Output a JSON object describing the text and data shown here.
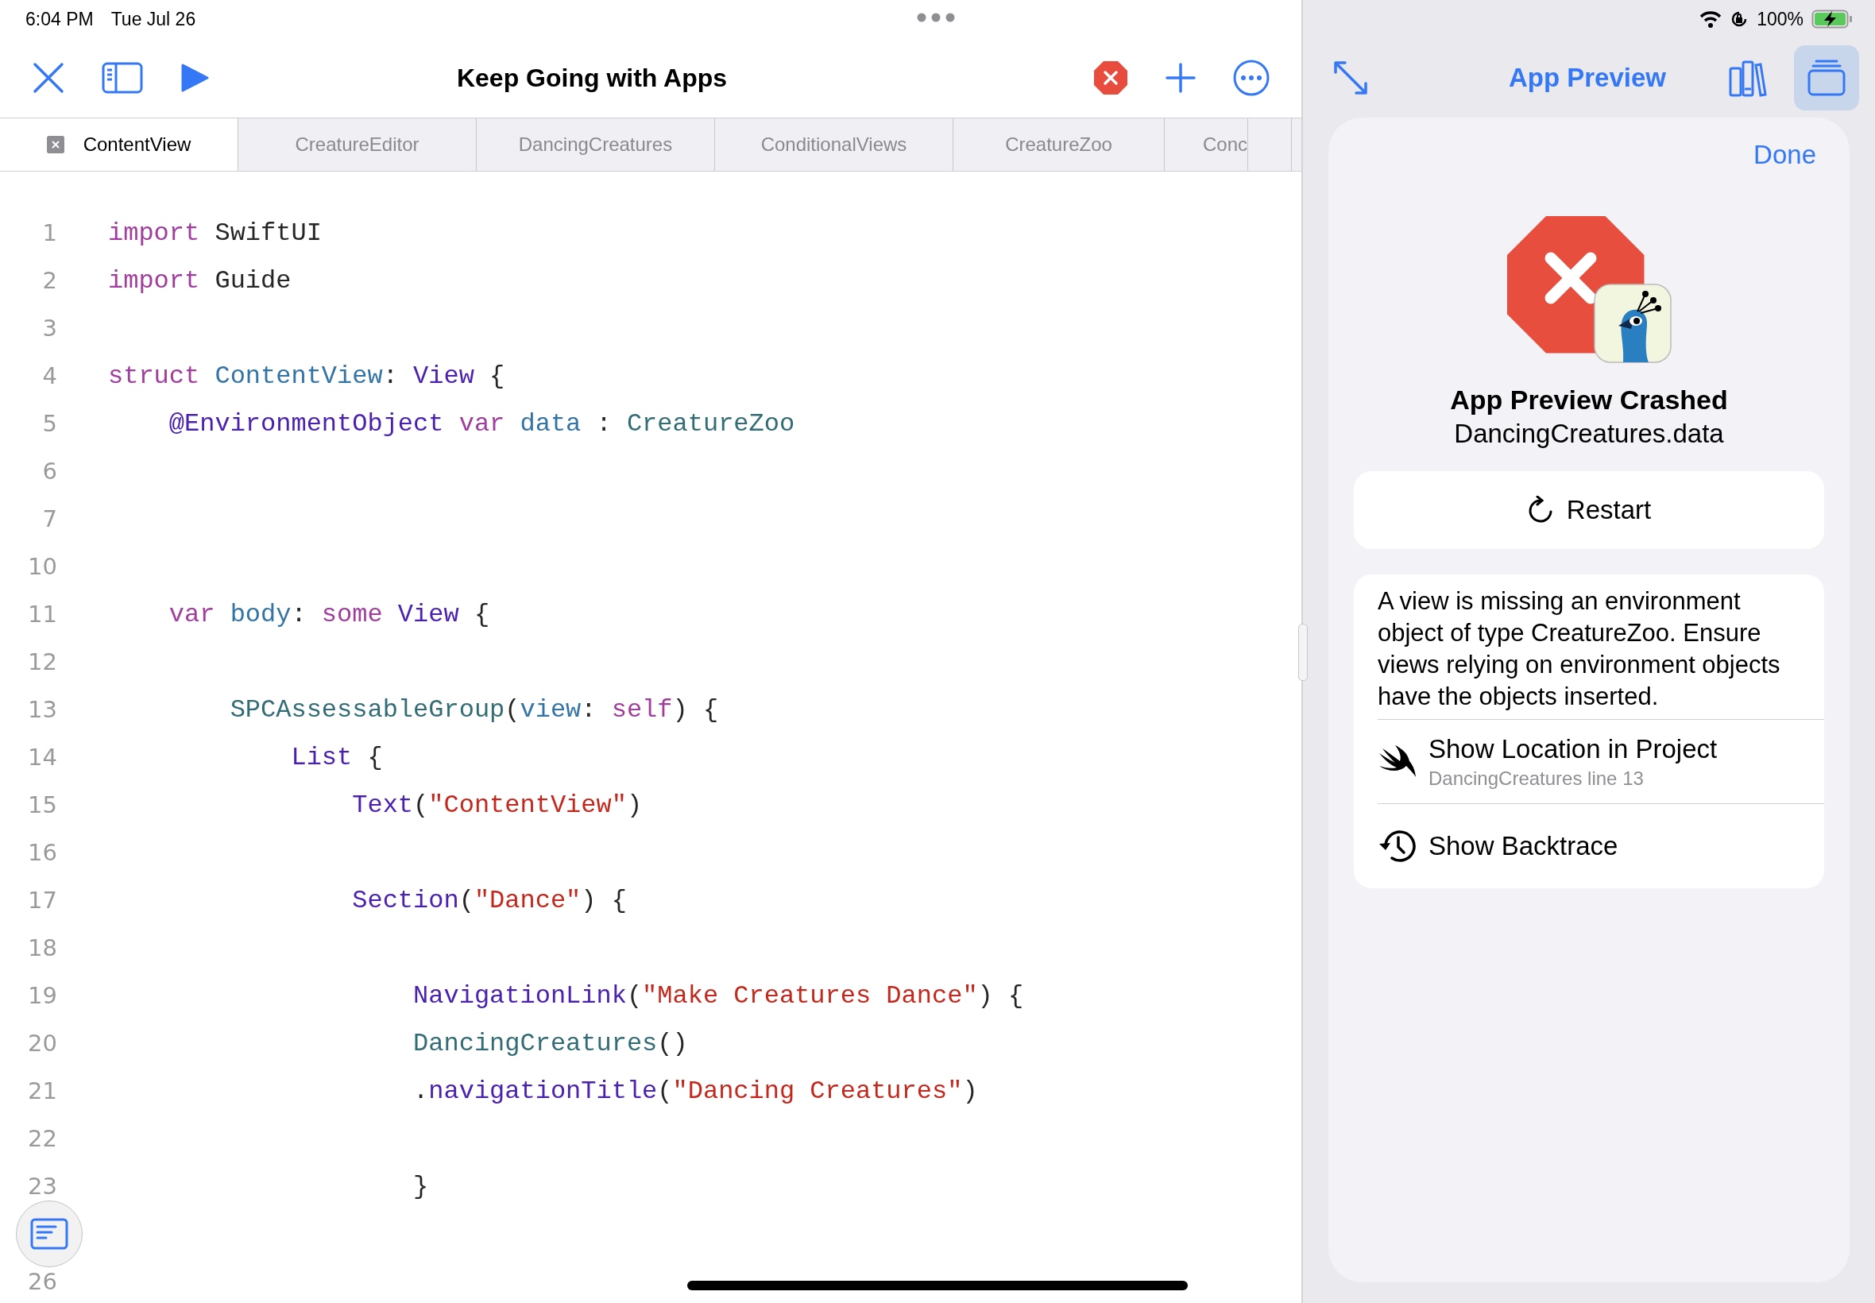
{
  "status_bar": {
    "time": "6:04 PM",
    "date": "Tue Jul 26",
    "battery": "100%"
  },
  "editor_toolbar": {
    "title": "Keep Going with Apps"
  },
  "tabs": [
    {
      "label": "ContentView",
      "selected": true
    },
    {
      "label": "CreatureEditor",
      "selected": false
    },
    {
      "label": "DancingCreatures",
      "selected": false
    },
    {
      "label": "ConditionalViews",
      "selected": false
    },
    {
      "label": "CreatureZoo",
      "selected": false
    },
    {
      "label": "Conc",
      "selected": false
    }
  ],
  "code_lines": [
    {
      "number": "1",
      "code": [
        {
          "t": "import",
          "kind": "keyword"
        },
        {
          "t": " SwiftUI",
          "kind": "plain"
        }
      ]
    },
    {
      "number": "2",
      "code": [
        {
          "t": "import",
          "kind": "keyword"
        },
        {
          "t": " Guide",
          "kind": "plain"
        }
      ]
    },
    {
      "number": "3"
    },
    {
      "number": "4",
      "code": [
        {
          "t": "struct",
          "kind": "keyword"
        },
        {
          "t": " ContentView",
          "kind": "decl"
        },
        {
          "t": ": ",
          "kind": "plain"
        },
        {
          "t": "View",
          "kind": "type"
        },
        {
          "t": " {",
          "kind": "plain"
        }
      ]
    },
    {
      "number": "5",
      "code": [
        {
          "t": "    @EnvironmentObject",
          "kind": "type"
        },
        {
          "t": " var",
          "kind": "keyword"
        },
        {
          "t": " data",
          "kind": "decl"
        },
        {
          "t": " : ",
          "kind": "plain"
        },
        {
          "t": "CreatureZoo",
          "kind": "project"
        }
      ]
    },
    {
      "number": "6"
    },
    {
      "number": "7"
    },
    {
      "number": "10"
    },
    {
      "number": "11",
      "code": [
        {
          "t": "    var",
          "kind": "keyword"
        },
        {
          "t": " body",
          "kind": "decl"
        },
        {
          "t": ": ",
          "kind": "plain"
        },
        {
          "t": "some",
          "kind": "keyword"
        },
        {
          "t": " View",
          "kind": "type"
        },
        {
          "t": " {",
          "kind": "plain"
        }
      ]
    },
    {
      "number": "12"
    },
    {
      "number": "13",
      "code": [
        {
          "t": "        SPCAssessableGroup",
          "kind": "project"
        },
        {
          "t": "(",
          "kind": "plain"
        },
        {
          "t": "view",
          "kind": "decl"
        },
        {
          "t": ": ",
          "kind": "plain"
        },
        {
          "t": "self",
          "kind": "keyword"
        },
        {
          "t": ") {",
          "kind": "plain"
        }
      ]
    },
    {
      "number": "14",
      "code": [
        {
          "t": "            List",
          "kind": "type"
        },
        {
          "t": " {",
          "kind": "plain"
        }
      ]
    },
    {
      "number": "15",
      "code": [
        {
          "t": "                Text",
          "kind": "type"
        },
        {
          "t": "(",
          "kind": "plain"
        },
        {
          "t": "\"ContentView\"",
          "kind": "string"
        },
        {
          "t": ")",
          "kind": "plain"
        }
      ]
    },
    {
      "number": "16"
    },
    {
      "number": "17",
      "code": [
        {
          "t": "                Section",
          "kind": "type"
        },
        {
          "t": "(",
          "kind": "plain"
        },
        {
          "t": "\"Dance\"",
          "kind": "string"
        },
        {
          "t": ") {",
          "kind": "plain"
        }
      ]
    },
    {
      "number": "18"
    },
    {
      "number": "19",
      "code": [
        {
          "t": "                    NavigationLink",
          "kind": "type"
        },
        {
          "t": "(",
          "kind": "plain"
        },
        {
          "t": "\"Make Creatures Dance\"",
          "kind": "string"
        },
        {
          "t": ") {",
          "kind": "plain"
        }
      ]
    },
    {
      "number": "20",
      "code": [
        {
          "t": "                    DancingCreatures",
          "kind": "project"
        },
        {
          "t": "()",
          "kind": "plain"
        }
      ]
    },
    {
      "number": "21",
      "code": [
        {
          "t": "                    .",
          "kind": "plain"
        },
        {
          "t": "navigationTitle",
          "kind": "type"
        },
        {
          "t": "(",
          "kind": "plain"
        },
        {
          "t": "\"Dancing Creatures\"",
          "kind": "string"
        },
        {
          "t": ")",
          "kind": "plain"
        }
      ]
    },
    {
      "number": "22"
    },
    {
      "number": "23",
      "code": [
        {
          "t": "                    }",
          "kind": "plain"
        }
      ]
    },
    {
      "number": "26"
    }
  ],
  "preview_toolbar": {
    "title": "App Preview",
    "library_selected": false,
    "window_selected": true
  },
  "crash_card": {
    "done": "Done",
    "title": "App Preview Crashed",
    "subtitle": "DancingCreatures.data",
    "restart": "Restart",
    "message": "A view is missing an environment object of type CreatureZoo. Ensure views relying on environment objects have the objects inserted.",
    "actions": [
      {
        "kind": "location",
        "label": "Show Location in Project",
        "detail": "DancingCreatures line 13"
      },
      {
        "kind": "backtrace",
        "label": "Show Backtrace"
      }
    ]
  }
}
